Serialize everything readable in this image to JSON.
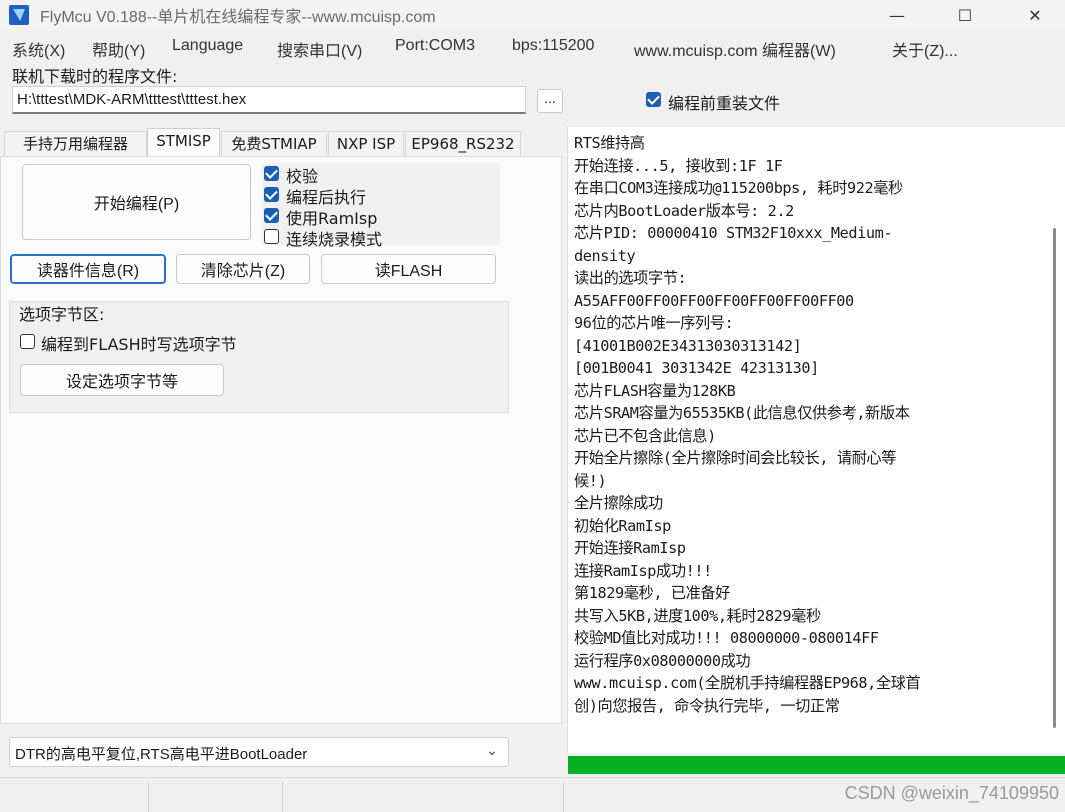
{
  "window": {
    "title": "FlyMcu V0.188--单片机在线编程专家--www.mcuisp.com",
    "minimize": "—",
    "maximize": "☐",
    "close": "✕"
  },
  "menu": [
    "系统(X)",
    "帮助(Y)",
    "Language",
    "搜索串口(V)",
    "Port:COM3",
    "bps:115200",
    "www.mcuisp.com 编程器(W)",
    "关于(Z)..."
  ],
  "file": {
    "label": "联机下载时的程序文件:",
    "path": "H:\\tttest\\MDK-ARM\\tttest\\tttest.hex",
    "browse": "...",
    "reload_label": "编程前重装文件",
    "reload_checked": true
  },
  "tabs": [
    "手持万用编程器",
    "STMISP",
    "免费STMIAP",
    "NXP ISP",
    "EP968_RS232"
  ],
  "active_tab": 1,
  "stmisp": {
    "start_button": "开始编程(P)",
    "options": [
      {
        "label": "校验",
        "checked": true
      },
      {
        "label": "编程后执行",
        "checked": true
      },
      {
        "label": "使用RamIsp",
        "checked": true
      },
      {
        "label": "连续烧录模式",
        "checked": false
      }
    ],
    "read_info_button": "读器件信息(R)",
    "erase_button": "清除芯片(Z)",
    "read_flash_button": "读FLASH",
    "option_group_title": "选项字节区:",
    "write_option_label": "编程到FLASH时写选项字节",
    "write_option_checked": false,
    "set_option_button": "设定选项字节等"
  },
  "boot_mode": "DTR的高电平复位,RTS高电平进BootLoader",
  "log_lines": [
    "RTS维持高",
    "开始连接...5, 接收到:1F 1F",
    "在串口COM3连接成功@115200bps, 耗时922毫秒",
    "芯片内BootLoader版本号: 2.2",
    "芯片PID: 00000410  STM32F10xxx_Medium-",
    "density",
    "读出的选项字节:",
    "A55AFF00FF00FF00FF00FF00FF00FF00",
    "96位的芯片唯一序列号:",
    "[41001B002E34313030313142]",
    "[001B0041 3031342E 42313130]",
    "芯片FLASH容量为128KB",
    "芯片SRAM容量为65535KB(此信息仅供参考,新版本",
    "芯片已不包含此信息)",
    "开始全片擦除(全片擦除时间会比较长, 请耐心等",
    "候!)",
    "全片擦除成功",
    "初始化RamIsp",
    "开始连接RamIsp",
    "连接RamIsp成功!!!",
    "第1829毫秒, 已准备好",
    "共写入5KB,进度100%,耗时2829毫秒",
    "校验MD值比对成功!!! 08000000-080014FF",
    "运行程序0x08000000成功",
    "www.mcuisp.com(全脱机手持编程器EP968,全球首",
    "创)向您报告, 命令执行完毕, 一切正常"
  ],
  "progress_percent": 100,
  "watermark": "CSDN @weixin_74109950",
  "colors": {
    "accent": "#1a5fb4",
    "progress": "#06b025"
  },
  "icons": {
    "app": "flymcu-icon",
    "dropdown": "chevron-down-icon"
  }
}
